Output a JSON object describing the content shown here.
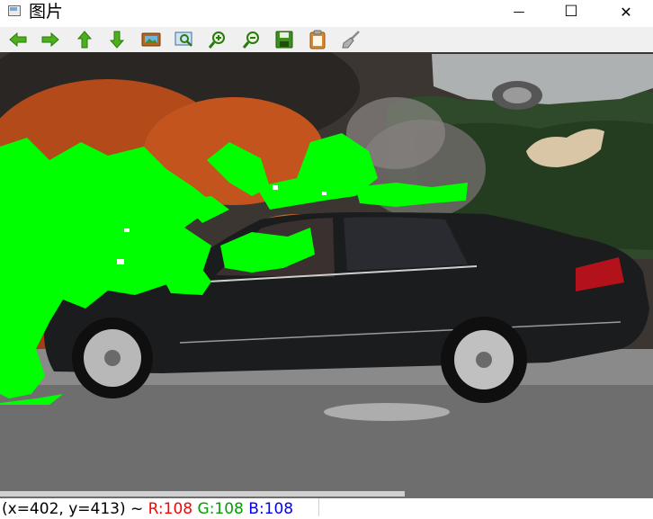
{
  "window": {
    "title": "图片",
    "minimize_glyph": "—",
    "maximize_glyph": "☐",
    "close_glyph": "✕"
  },
  "toolbar": {
    "buttons": [
      {
        "icon": "arrow-left-icon"
      },
      {
        "icon": "arrow-right-icon"
      },
      {
        "icon": "arrow-up-icon"
      },
      {
        "icon": "arrow-down-icon"
      },
      {
        "icon": "image-icon"
      },
      {
        "icon": "zoom-fit-icon"
      },
      {
        "icon": "zoom-in-icon"
      },
      {
        "icon": "zoom-out-icon"
      },
      {
        "icon": "save-icon"
      },
      {
        "icon": "clipboard-icon"
      },
      {
        "icon": "brush-icon"
      }
    ]
  },
  "status": {
    "coords": "(x=402, y=413) ~ ",
    "r": "R:108",
    "g": "G:108",
    "b": "B:108"
  },
  "colors": {
    "fire_mask": "#00ff00",
    "r_text": "#ff0000",
    "g_text": "#00a000",
    "b_text": "#0000ff"
  }
}
